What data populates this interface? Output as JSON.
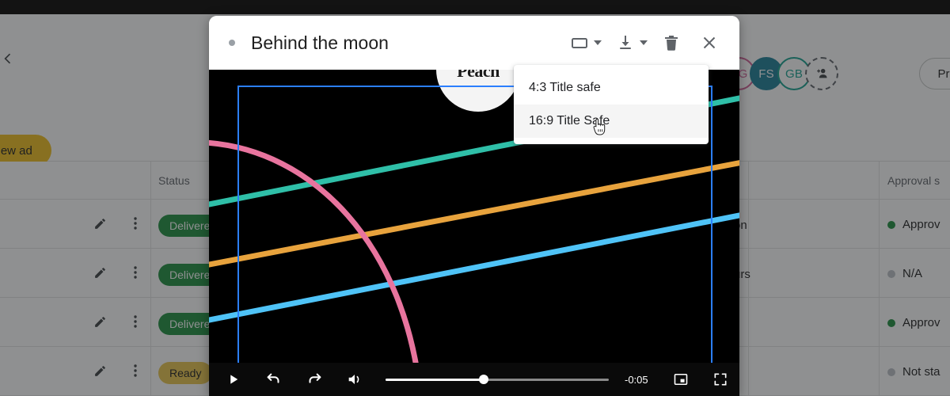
{
  "background": {
    "back_icon": "back-arrow-icon",
    "new_ad_label": "New ad",
    "proof_button_label": "Proof of",
    "avatars": [
      {
        "initials": "CG",
        "style": "outline-pink"
      },
      {
        "initials": "FS",
        "style": "filled-teal"
      },
      {
        "initials": "GB",
        "style": "outline-green"
      }
    ],
    "add_person_icon": "add-person-icon",
    "table": {
      "headers": {
        "status": "Status",
        "approval": "Approval s"
      },
      "rows": [
        {
          "status": "Delivere",
          "detail": "on",
          "approval": "Approv",
          "approval_dot": "green"
        },
        {
          "status": "Delivere",
          "detail": "urs",
          "approval": "N/A",
          "approval_dot": "grey"
        },
        {
          "status": "Delivere",
          "detail": "",
          "approval": "Approv",
          "approval_dot": "green"
        },
        {
          "status": "Ready",
          "detail": "",
          "approval": "Not sta",
          "approval_dot": "grey"
        }
      ],
      "row_icons": {
        "edit": "pencil-icon",
        "more": "kebab-menu-icon"
      }
    }
  },
  "modal": {
    "status_dot": "unsaved-indicator-dot",
    "title": "Behind the moon",
    "actions": {
      "aspect_ratio_icon": "rectangle-icon",
      "aspect_ratio_caret": "chevron-down-icon",
      "download_icon": "download-icon",
      "download_caret": "chevron-down-icon",
      "delete_icon": "trash-icon",
      "close_icon": "close-icon"
    },
    "menu": {
      "items": [
        {
          "label": "4:3 Title safe",
          "hovered": false
        },
        {
          "label": "16:9 Title Safe",
          "hovered": true
        }
      ]
    },
    "video": {
      "watermark_text": "Peach",
      "safe_frame_color": "#2b7fff",
      "line_colors": {
        "teal": "#2fbfa8",
        "orange": "#e8a33d",
        "blue": "#4fc3f7",
        "pink": "#e8749e"
      },
      "background_color": "#000000"
    },
    "controls": {
      "play_icon": "play-icon",
      "undo_icon": "undo-icon",
      "redo_icon": "redo-icon",
      "volume_icon": "volume-icon",
      "time_remaining": "-0:05",
      "progress_percent": 44,
      "pip_icon": "picture-in-picture-icon",
      "fullscreen_icon": "fullscreen-icon"
    }
  }
}
